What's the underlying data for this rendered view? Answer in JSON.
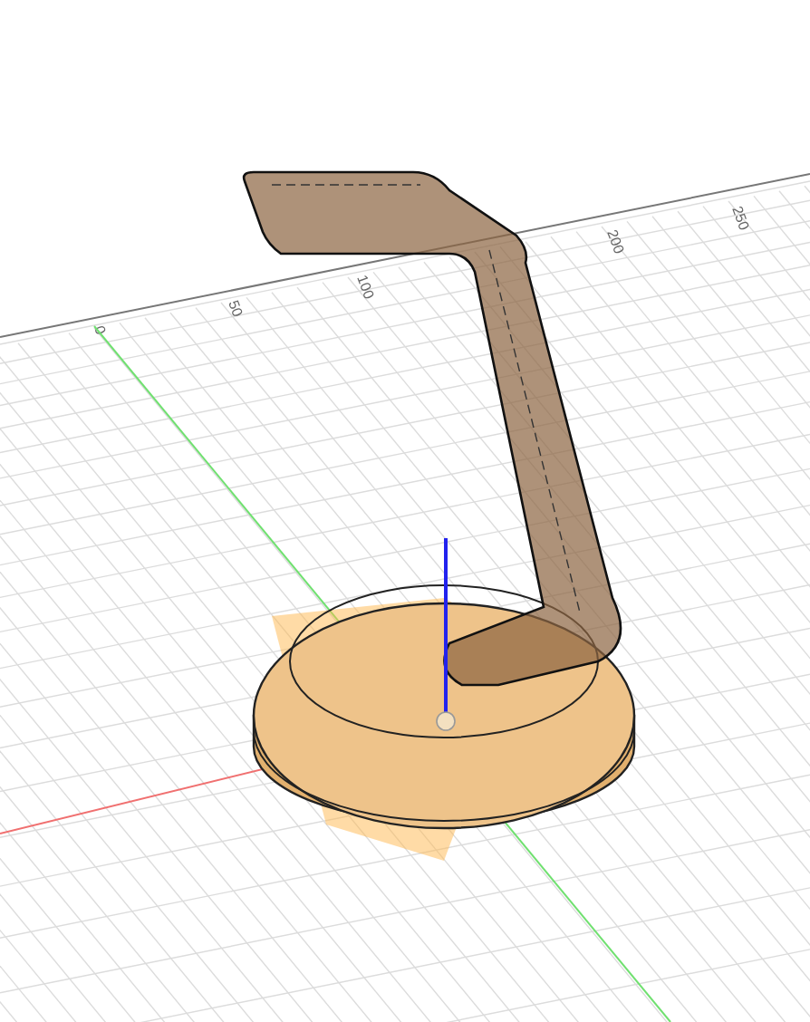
{
  "viewport": {
    "ruler_labels": [
      "0",
      "50",
      "100",
      "200",
      "250"
    ]
  }
}
